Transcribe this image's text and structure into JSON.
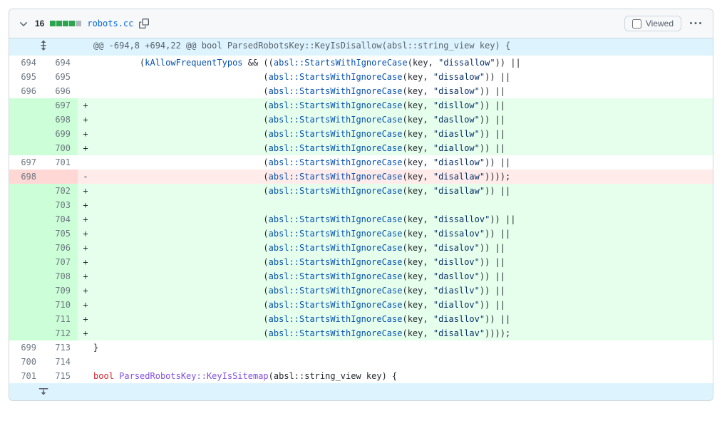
{
  "header": {
    "count": "16",
    "filename": "robots.cc",
    "viewed_label": "Viewed"
  },
  "hunk": {
    "header": "@@ -694,8 +694,22 @@ bool ParsedRobotsKey::KeyIsDisallow(absl::string_view key) {"
  },
  "lines": [
    {
      "type": "ctx",
      "old": "694",
      "new": "694",
      "indent": "         ",
      "prefix": "(",
      "sym": "kAllowFrequentTypos",
      "mid": " && ((",
      "call": "absl::StartsWithIgnoreCase",
      "args_open": "(key, ",
      "str": "\"dissallow\"",
      "tail": ")) ||"
    },
    {
      "type": "ctx",
      "old": "695",
      "new": "695",
      "indent": "                                 ",
      "prefix": "(",
      "sym": "",
      "mid": "",
      "call": "absl::StartsWithIgnoreCase",
      "args_open": "(key, ",
      "str": "\"dissalow\"",
      "tail": ")) ||"
    },
    {
      "type": "ctx",
      "old": "696",
      "new": "696",
      "indent": "                                 ",
      "prefix": "(",
      "sym": "",
      "mid": "",
      "call": "absl::StartsWithIgnoreCase",
      "args_open": "(key, ",
      "str": "\"disalow\"",
      "tail": ")) ||"
    },
    {
      "type": "add",
      "old": "",
      "new": "697",
      "indent": "                                 ",
      "prefix": "(",
      "sym": "",
      "mid": "",
      "call": "absl::StartsWithIgnoreCase",
      "args_open": "(key, ",
      "str": "\"disllow\"",
      "tail": ")) ||"
    },
    {
      "type": "add",
      "old": "",
      "new": "698",
      "indent": "                                 ",
      "prefix": "(",
      "sym": "",
      "mid": "",
      "call": "absl::StartsWithIgnoreCase",
      "args_open": "(key, ",
      "str": "\"dasllow\"",
      "tail": ")) ||"
    },
    {
      "type": "add",
      "old": "",
      "new": "699",
      "indent": "                                 ",
      "prefix": "(",
      "sym": "",
      "mid": "",
      "call": "absl::StartsWithIgnoreCase",
      "args_open": "(key, ",
      "str": "\"diasllw\"",
      "tail": ")) ||"
    },
    {
      "type": "add",
      "old": "",
      "new": "700",
      "indent": "                                 ",
      "prefix": "(",
      "sym": "",
      "mid": "",
      "call": "absl::StartsWithIgnoreCase",
      "args_open": "(key, ",
      "str": "\"diallow\"",
      "tail": ")) ||"
    },
    {
      "type": "ctx",
      "old": "697",
      "new": "701",
      "indent": "                                 ",
      "prefix": "(",
      "sym": "",
      "mid": "",
      "call": "absl::StartsWithIgnoreCase",
      "args_open": "(key, ",
      "str": "\"diasllow\"",
      "tail": ")) ||"
    },
    {
      "type": "del",
      "old": "698",
      "new": "",
      "indent": "                                 ",
      "prefix": "(",
      "sym": "",
      "mid": "",
      "call": "absl::StartsWithIgnoreCase",
      "args_open": "(key, ",
      "str": "\"disallaw\"",
      "tail": "))));"
    },
    {
      "type": "add",
      "old": "",
      "new": "702",
      "indent": "                                 ",
      "prefix": "(",
      "sym": "",
      "mid": "",
      "call": "absl::StartsWithIgnoreCase",
      "args_open": "(key, ",
      "str": "\"disallaw\"",
      "tail": ")) ||"
    },
    {
      "type": "add",
      "old": "",
      "new": "703",
      "indent": "",
      "prefix": "",
      "sym": "",
      "mid": "",
      "call": "",
      "args_open": "",
      "str": "",
      "tail": ""
    },
    {
      "type": "add",
      "old": "",
      "new": "704",
      "indent": "                                 ",
      "prefix": "(",
      "sym": "",
      "mid": "",
      "call": "absl::StartsWithIgnoreCase",
      "args_open": "(key, ",
      "str": "\"dissallov\"",
      "tail": ")) ||"
    },
    {
      "type": "add",
      "old": "",
      "new": "705",
      "indent": "                                 ",
      "prefix": "(",
      "sym": "",
      "mid": "",
      "call": "absl::StartsWithIgnoreCase",
      "args_open": "(key, ",
      "str": "\"dissalov\"",
      "tail": ")) ||"
    },
    {
      "type": "add",
      "old": "",
      "new": "706",
      "indent": "                                 ",
      "prefix": "(",
      "sym": "",
      "mid": "",
      "call": "absl::StartsWithIgnoreCase",
      "args_open": "(key, ",
      "str": "\"disalov\"",
      "tail": ")) ||"
    },
    {
      "type": "add",
      "old": "",
      "new": "707",
      "indent": "                                 ",
      "prefix": "(",
      "sym": "",
      "mid": "",
      "call": "absl::StartsWithIgnoreCase",
      "args_open": "(key, ",
      "str": "\"disllov\"",
      "tail": ")) ||"
    },
    {
      "type": "add",
      "old": "",
      "new": "708",
      "indent": "                                 ",
      "prefix": "(",
      "sym": "",
      "mid": "",
      "call": "absl::StartsWithIgnoreCase",
      "args_open": "(key, ",
      "str": "\"dasllov\"",
      "tail": ")) ||"
    },
    {
      "type": "add",
      "old": "",
      "new": "709",
      "indent": "                                 ",
      "prefix": "(",
      "sym": "",
      "mid": "",
      "call": "absl::StartsWithIgnoreCase",
      "args_open": "(key, ",
      "str": "\"diasllv\"",
      "tail": ")) ||"
    },
    {
      "type": "add",
      "old": "",
      "new": "710",
      "indent": "                                 ",
      "prefix": "(",
      "sym": "",
      "mid": "",
      "call": "absl::StartsWithIgnoreCase",
      "args_open": "(key, ",
      "str": "\"diallov\"",
      "tail": ")) ||"
    },
    {
      "type": "add",
      "old": "",
      "new": "711",
      "indent": "                                 ",
      "prefix": "(",
      "sym": "",
      "mid": "",
      "call": "absl::StartsWithIgnoreCase",
      "args_open": "(key, ",
      "str": "\"diasllov\"",
      "tail": ")) ||"
    },
    {
      "type": "add",
      "old": "",
      "new": "712",
      "indent": "                                 ",
      "prefix": "(",
      "sym": "",
      "mid": "",
      "call": "absl::StartsWithIgnoreCase",
      "args_open": "(key, ",
      "str": "\"disallav\"",
      "tail": "))));"
    },
    {
      "type": "ctx",
      "old": "699",
      "new": "713",
      "raw": "}"
    },
    {
      "type": "ctx",
      "old": "700",
      "new": "714",
      "raw": ""
    },
    {
      "type": "sig",
      "old": "701",
      "new": "715",
      "kw": "bool",
      "fn": "ParsedRobotsKey::KeyIsSitemap",
      "rest": "(absl::string_view key) {"
    }
  ]
}
